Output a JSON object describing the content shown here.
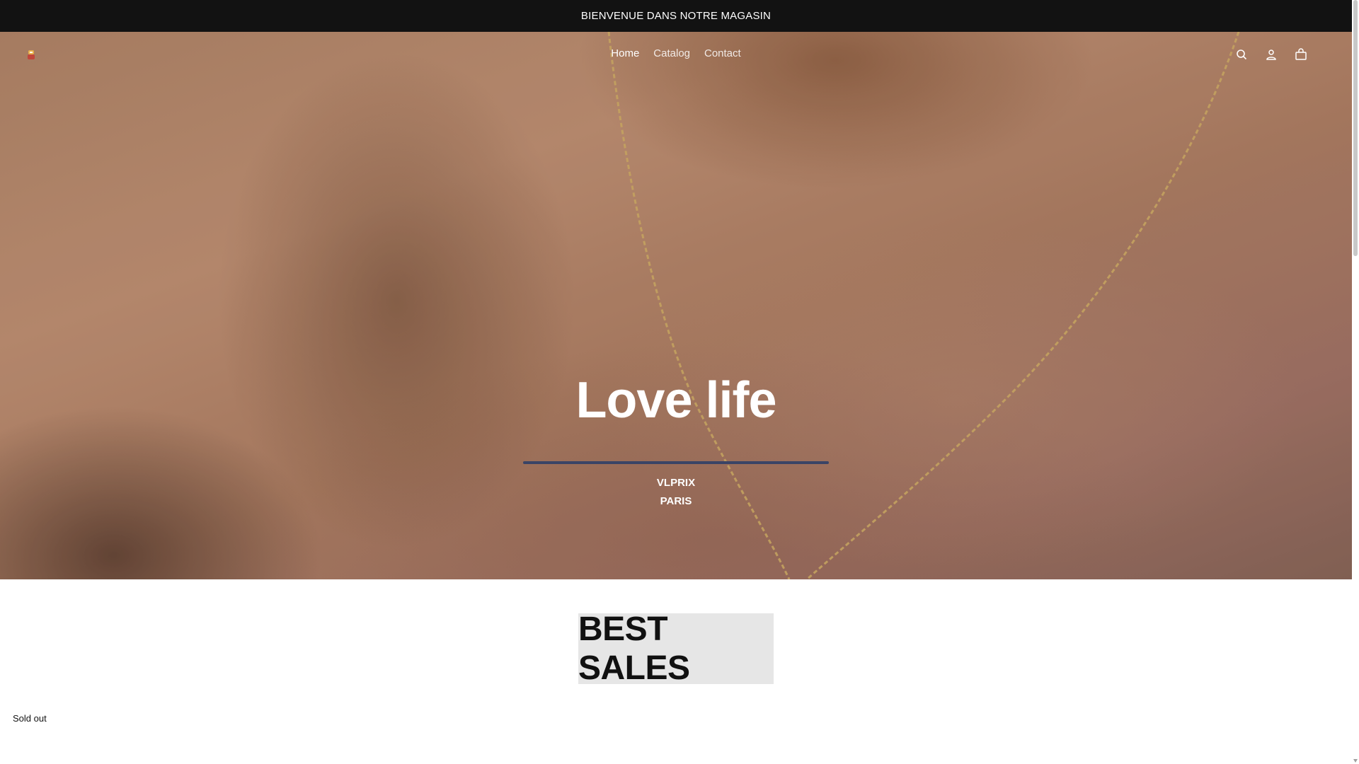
{
  "announcement": {
    "text": "BIENVENUE DANS NOTRE MAGASIN"
  },
  "header": {
    "logo_icon": "store-logo-icon",
    "nav": [
      {
        "label": "Home",
        "active": true
      },
      {
        "label": "Catalog",
        "active": false
      },
      {
        "label": "Contact",
        "active": false
      }
    ],
    "icons": [
      "search-icon",
      "account-icon",
      "cart-icon"
    ]
  },
  "hero": {
    "title": "Love life",
    "subtitle_line1": "VLPRIX",
    "subtitle_line2": "PARIS",
    "divider_color": "#3a4466"
  },
  "section": {
    "heading": "BEST SALES",
    "product_badge": "Sold out"
  },
  "colors": {
    "announcement_bg": "#121212",
    "heading_bg": "#e6e6e6"
  }
}
